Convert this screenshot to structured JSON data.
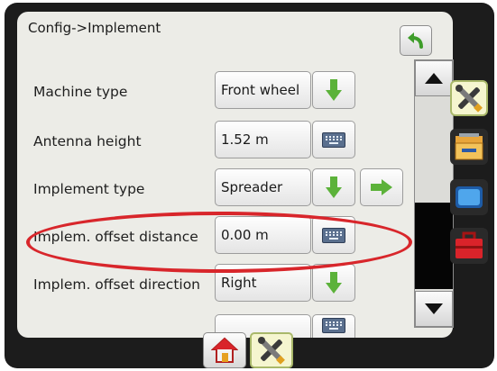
{
  "header": {
    "breadcrumb": "Config->Implement"
  },
  "rows": [
    {
      "label": "Machine type",
      "value": "Front wheel",
      "control": "dropdown"
    },
    {
      "label": "Antenna height",
      "value": "1.52 m",
      "control": "keyboard"
    },
    {
      "label": "Implement type",
      "value": "Spreader",
      "control": "dropdown",
      "extra": "next"
    },
    {
      "label": "Implem. offset distance",
      "value": "0.00 m",
      "control": "keyboard"
    },
    {
      "label": "Implem. offset direction",
      "value": "Right",
      "control": "dropdown"
    }
  ],
  "colors": {
    "highlight": "#d8262b",
    "green_arrow": "#5cb23a",
    "active_tab": "#f5f5cf"
  },
  "icons": {
    "back": "undo-arrow-icon",
    "dropdown": "green-down-arrow-icon",
    "next": "green-right-arrow-icon",
    "keyboard": "keyboard-icon",
    "side_tabs": [
      "tools-icon",
      "console-icon",
      "screen-icon",
      "toolbox-icon"
    ],
    "bottom_tabs": [
      "home-icon",
      "tools-icon"
    ]
  }
}
